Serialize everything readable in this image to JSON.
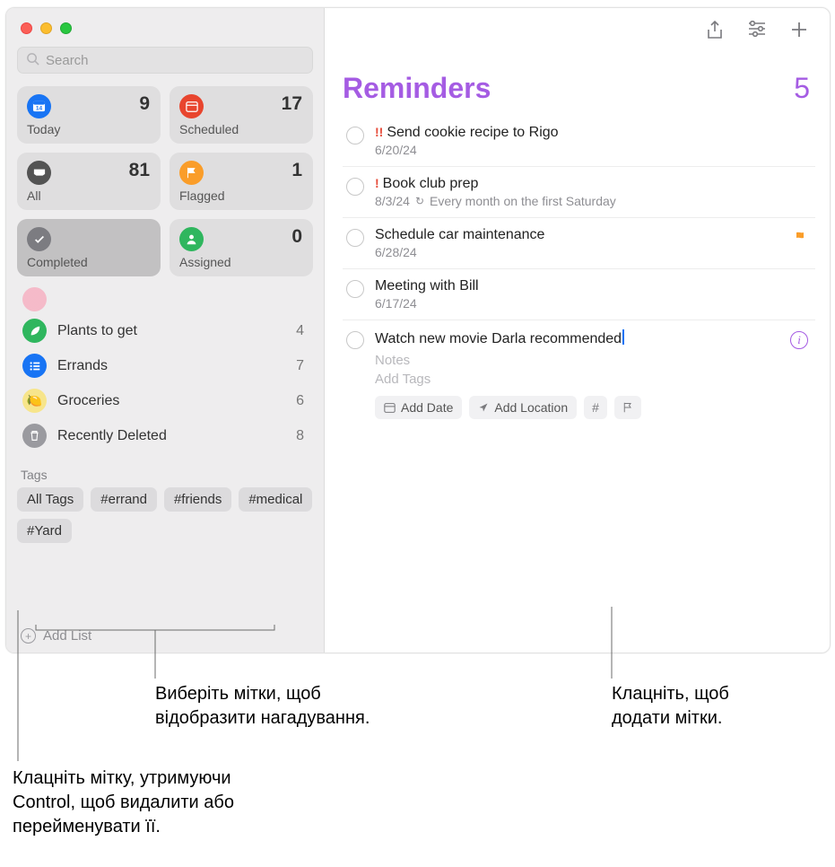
{
  "search": {
    "placeholder": "Search"
  },
  "smart": {
    "today": {
      "label": "Today",
      "count": "9",
      "day": "14"
    },
    "scheduled": {
      "label": "Scheduled",
      "count": "17"
    },
    "all": {
      "label": "All",
      "count": "81"
    },
    "flagged": {
      "label": "Flagged",
      "count": "1"
    },
    "completed": {
      "label": "Completed",
      "count": ""
    },
    "assigned": {
      "label": "Assigned",
      "count": "0"
    }
  },
  "lists": [
    {
      "label": "Plants to get",
      "count": "4"
    },
    {
      "label": "Errands",
      "count": "7"
    },
    {
      "label": "Groceries",
      "count": "6"
    },
    {
      "label": "Recently Deleted",
      "count": "8"
    }
  ],
  "tags": {
    "heading": "Tags",
    "items": [
      "All Tags",
      "#errand",
      "#friends",
      "#medical",
      "#Yard"
    ]
  },
  "addList": "Add List",
  "header": {
    "title": "Reminders",
    "count": "5"
  },
  "reminders": [
    {
      "priority": "!!",
      "title": "Send cookie recipe to Rigo",
      "sub": "6/20/24"
    },
    {
      "priority": "!",
      "title": "Book club prep",
      "sub": "8/3/24",
      "repeat": "Every month on the first Saturday"
    },
    {
      "priority": "",
      "title": "Schedule car maintenance",
      "sub": "6/28/24",
      "flagged": true
    },
    {
      "priority": "",
      "title": "Meeting with Bill",
      "sub": "6/17/24"
    },
    {
      "priority": "",
      "title": "Watch new movie Darla recommended",
      "editing": true,
      "notesPH": "Notes",
      "tagsPH": "Add Tags",
      "pills": {
        "date": "Add Date",
        "loc": "Add Location"
      }
    }
  ],
  "callouts": {
    "selectTags": "Виберіть мітки, щоб\nвідобразити нагадування.",
    "addTags": "Клацніть, щоб\nдодати мітки.",
    "ctrlClick": "Клацніть мітку, утримуючи\nControl, щоб видалити або\nперейменувати її."
  }
}
